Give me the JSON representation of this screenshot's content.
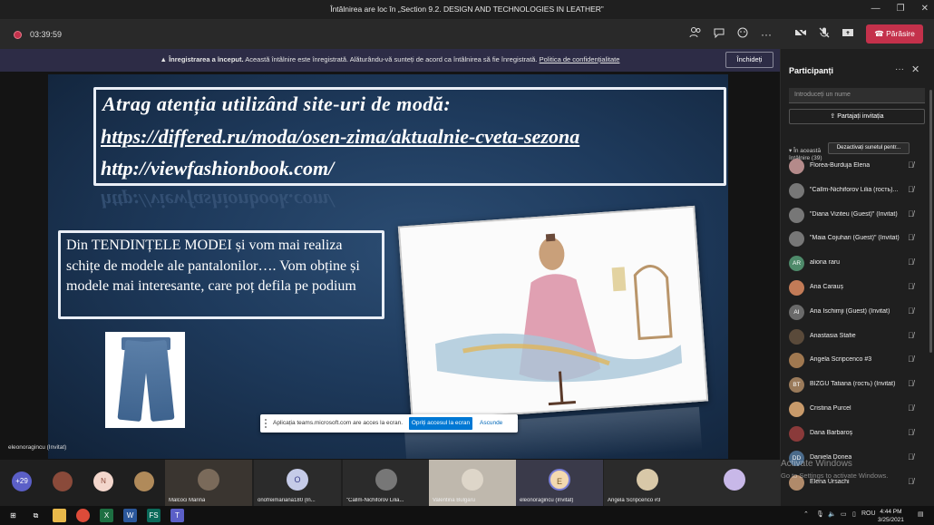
{
  "window": {
    "title": "Întâlnirea are loc în „Section 9.2. DESIGN AND TECHNOLOGIES IN LEATHER”",
    "min": "—",
    "max": "❐",
    "close": "✕"
  },
  "toolbar": {
    "recording_time": "03:39:59",
    "leave_label": "Părăsire",
    "icons": [
      "participants-icon",
      "chat-icon",
      "reactions-icon",
      "more-icon",
      "camera-off-icon",
      "mic-off-icon",
      "share-icon"
    ]
  },
  "banner": {
    "bold": "Înregistrarea a început.",
    "text": " Această întâlnire este înregistrată. Alăturându-vă sunteți de acord ca întâlnirea să fie înregistrată. ",
    "link": "Politica de confidențialitate",
    "close_label": "Închideți"
  },
  "slide": {
    "line1": "Atrag atenția utilizând  site-uri de modă:",
    "line2": "https://differed.ru/moda/osen-zima/aktualnie-cveta-sezona",
    "line3": "http://viewfashionbook.com/",
    "body": "Din TENDINȚELE MODEI și vom mai realiza schițe de modele ale pantalonilor…. Vom obține și  modele mai interesante, care poț defila pe podium",
    "presenter": "eleonoragincu (Invitat)"
  },
  "toast": {
    "message": "Aplicația teams.microsoft.com are acces la ecran.",
    "stop_label": "Opriți accesul la ecran",
    "hide_label": "Ascunde"
  },
  "strip": {
    "overflow_count": "+29",
    "n_initial": "N",
    "tiles": [
      {
        "label": "Malcoci Marina"
      },
      {
        "label": "onofreimariana180 (In...",
        "initial": "O"
      },
      {
        "label": "\"Callm-Nichiforov Lilia..."
      },
      {
        "label": "Valentina Bulgaru"
      },
      {
        "label": "eleonoragincu (Invitat)",
        "initial": "E"
      },
      {
        "label": "Angela Scripcenco #3"
      }
    ]
  },
  "panel": {
    "title": "Participanți",
    "search_placeholder": "Introduceți un nume",
    "share_label": "Partajați invitația",
    "section_label": "În această\nîntâlnire (39)",
    "mute_all_label": "Dezactivați sunetul pentr...",
    "participants": [
      {
        "name": "Florea-Burduja Elena",
        "initials": "",
        "color": "#b48a8a"
      },
      {
        "name": "\"Callm-Nichiforov Lilia (гость)...",
        "initials": "",
        "color": "#777777"
      },
      {
        "name": "\"Diana Viziteu (Guest)\" (Invitat)",
        "initials": "",
        "color": "#777777"
      },
      {
        "name": "\"Maia Cojuhari (Guest)\" (Invitat)",
        "initials": "",
        "color": "#777777"
      },
      {
        "name": "aliona raru",
        "initials": "AR",
        "color": "#4e8a6a"
      },
      {
        "name": "Ana Carauș",
        "initials": "",
        "color": "#c27b57"
      },
      {
        "name": "Ana Ischimji (Guest) (Invitat)",
        "initials": "AI",
        "color": "#6a6a6a"
      },
      {
        "name": "Anastasia Stafie",
        "initials": "",
        "color": "#5a4a3a"
      },
      {
        "name": "Angela Scripcenco #3",
        "initials": "",
        "color": "#a07850"
      },
      {
        "name": "BÎZGU Tatiana (гость) (Invitat)",
        "initials": "BT",
        "color": "#9a7a5a"
      },
      {
        "name": "Cristina Purcel",
        "initials": "",
        "color": "#c89a6a"
      },
      {
        "name": "Dana Barbaroș",
        "initials": "",
        "color": "#8a3a3a"
      },
      {
        "name": "Daniela Donea",
        "initials": "DD",
        "color": "#4a6a8a"
      },
      {
        "name": "Elena Ursachi",
        "initials": "",
        "color": "#b08a6a"
      }
    ],
    "watermark1": "Activate Windows",
    "watermark2": "Go to Settings to activate Windows."
  },
  "taskbar": {
    "lang": "ROU",
    "time": "4:44 PM",
    "date": "3/25/2021"
  },
  "colors": {
    "leave": "#c4314b",
    "banner": "#2d2c46",
    "accent": "#0078d4"
  }
}
